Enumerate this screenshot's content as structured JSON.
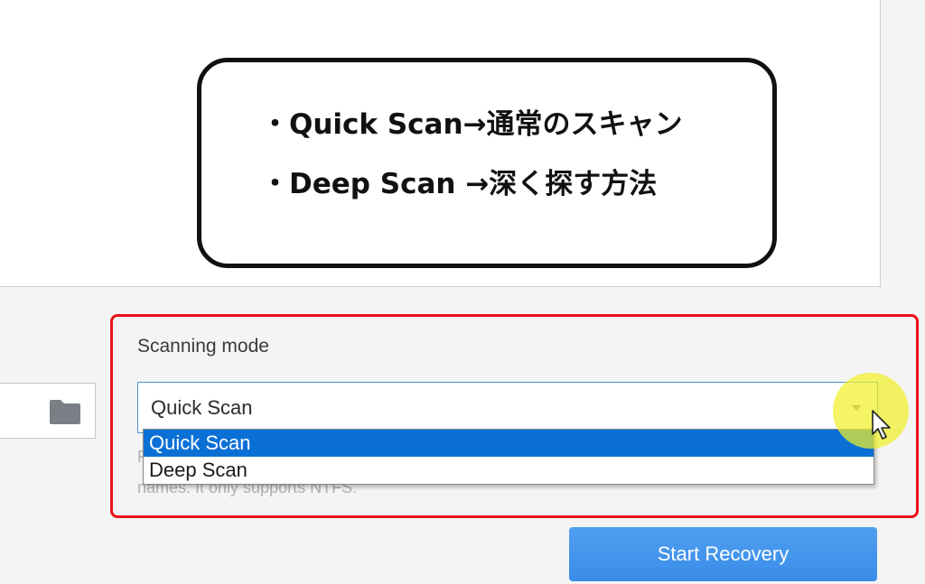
{
  "callout": {
    "line1": "・Quick Scan→通常のスキャン",
    "line2": "・Deep Scan →深く探す方法"
  },
  "scan": {
    "mode_label": "Scanning mode",
    "selected_value": "Quick Scan",
    "options": [
      "Quick Scan",
      "Deep Scan"
    ],
    "hint_fragment": "F",
    "hint_text": "names. It only supports NTFS."
  },
  "actions": {
    "start_label": "Start Recovery"
  },
  "colors": {
    "highlight": "#e8121c",
    "selected_option": "#0a70d6",
    "button": "#3a8ce8"
  },
  "icons": {
    "folder": "folder-icon",
    "caret": "chevron-down-icon",
    "cursor": "mouse-cursor-icon"
  }
}
